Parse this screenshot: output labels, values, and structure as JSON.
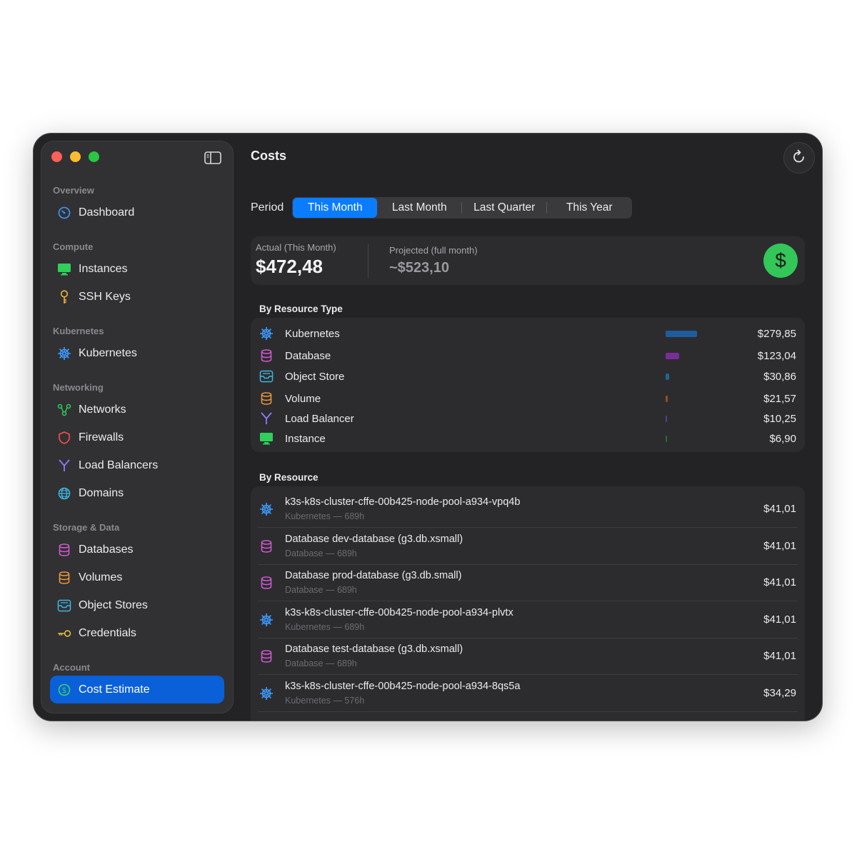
{
  "window": {
    "title": "Costs"
  },
  "sidebar": {
    "sections": [
      {
        "title": "Overview",
        "items": [
          {
            "label": "Dashboard",
            "icon": "gauge-icon"
          }
        ]
      },
      {
        "title": "Compute",
        "items": [
          {
            "label": "Instances",
            "icon": "monitor-icon"
          },
          {
            "label": "SSH Keys",
            "icon": "key-icon"
          }
        ]
      },
      {
        "title": "Kubernetes",
        "items": [
          {
            "label": "Kubernetes",
            "icon": "helm-icon"
          }
        ]
      },
      {
        "title": "Networking",
        "items": [
          {
            "label": "Networks",
            "icon": "network-icon"
          },
          {
            "label": "Firewalls",
            "icon": "shield-icon"
          },
          {
            "label": "Load Balancers",
            "icon": "fork-icon"
          },
          {
            "label": "Domains",
            "icon": "globe-icon"
          }
        ]
      },
      {
        "title": "Storage & Data",
        "items": [
          {
            "label": "Databases",
            "icon": "cylinder-icon"
          },
          {
            "label": "Volumes",
            "icon": "cylinder-icon"
          },
          {
            "label": "Object Stores",
            "icon": "tray-icon"
          },
          {
            "label": "Credentials",
            "icon": "key-horizontal-icon"
          }
        ]
      },
      {
        "title": "Account",
        "items": [
          {
            "label": "Cost Estimate",
            "icon": "dollar-circle-icon",
            "active": true
          }
        ]
      }
    ]
  },
  "period": {
    "label": "Period",
    "options": [
      "This Month",
      "Last Month",
      "Last Quarter",
      "This Year"
    ],
    "selected": "This Month"
  },
  "summary": {
    "actual_label": "Actual (This Month)",
    "actual_value": "$472,48",
    "projected_label": "Projected (full month)",
    "projected_value": "~$523,10"
  },
  "by_type": {
    "title": "By Resource Type",
    "rows": [
      {
        "name": "Kubernetes",
        "amount": "$279,85",
        "value": 279.85,
        "color": "#1e5c9e",
        "icon": "helm-icon"
      },
      {
        "name": "Database",
        "amount": "$123,04",
        "value": 123.04,
        "color": "#7a2d9a",
        "icon": "cylinder-icon"
      },
      {
        "name": "Object Store",
        "amount": "$30,86",
        "value": 30.86,
        "color": "#1f6fa5",
        "icon": "tray-icon"
      },
      {
        "name": "Volume",
        "amount": "$21,57",
        "value": 21.57,
        "color": "#a8561c",
        "icon": "cylinder-icon"
      },
      {
        "name": "Load Balancer",
        "amount": "$10,25",
        "value": 10.25,
        "color": "#4a4aa0",
        "icon": "fork-icon"
      },
      {
        "name": "Instance",
        "amount": "$6,90",
        "value": 6.9,
        "color": "#1f7a3a",
        "icon": "monitor-icon"
      }
    ]
  },
  "by_resource": {
    "title": "By Resource",
    "rows": [
      {
        "name": "k3s-k8s-cluster-cffe-00b425-node-pool-a934-vpq4b",
        "sub": "Kubernetes — 689h",
        "amount": "$41,01",
        "icon": "helm-icon"
      },
      {
        "name": "Database dev-database (g3.db.xsmall)",
        "sub": "Database — 689h",
        "amount": "$41,01",
        "icon": "cylinder-icon"
      },
      {
        "name": "Database prod-database (g3.db.small)",
        "sub": "Database — 689h",
        "amount": "$41,01",
        "icon": "cylinder-icon"
      },
      {
        "name": "k3s-k8s-cluster-cffe-00b425-node-pool-a934-plvtx",
        "sub": "Kubernetes — 689h",
        "amount": "$41,01",
        "icon": "helm-icon"
      },
      {
        "name": "Database test-database (g3.db.xsmall)",
        "sub": "Database — 689h",
        "amount": "$41,01",
        "icon": "cylinder-icon"
      },
      {
        "name": "k3s-k8s-cluster-cffe-00b425-node-pool-a934-8qs5a",
        "sub": "Kubernetes — 576h",
        "amount": "$34,29",
        "icon": "helm-icon"
      }
    ]
  }
}
